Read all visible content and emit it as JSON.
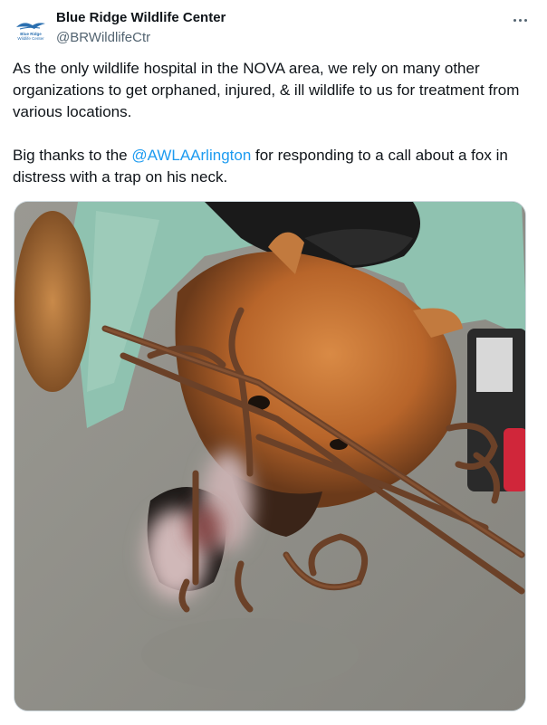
{
  "account": {
    "display_name": "Blue Ridge Wildlife Center",
    "handle": "@BRWildlifeCtr",
    "avatar_text": "Wildlife Center",
    "avatar_icon": "bird-logo-icon"
  },
  "menu": {
    "more_icon": "more-horizontal-icon"
  },
  "tweet": {
    "paragraph1": "As the only wildlife hospital in the NOVA area, we rely on many other organizations to get orphaned, injured, & ill wildlife to us for treatment from various locations.",
    "p2_before": "Big thanks to the ",
    "p2_mention": "@AWLAArlington",
    "p2_after": " for responding to a call about a fox in distress with a trap on his neck."
  },
  "colors": {
    "link": "#1d9bf0",
    "secondary_text": "#536471",
    "primary_text": "#0f1419"
  }
}
